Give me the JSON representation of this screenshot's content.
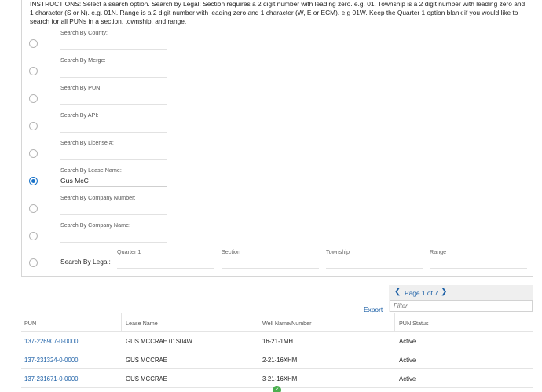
{
  "instructions": "INSTRUCTIONS: Select a search option. Search by Legal: Section requires a 2 digit number with leading zero. e.g. 01. Township is a 2 digit number with leading zero and 1 character (S or N). e.g. 01N. Range is a 2 digit number with leading zero and 1 character (W, E or ECM). e.g 01W. Keep the Quarter 1 option blank if you would like to search for all PUNs in a section, township, and range.",
  "search_options": [
    {
      "label": "Search By County:",
      "value": "",
      "selected": false
    },
    {
      "label": "Search By Merge:",
      "value": "",
      "selected": false
    },
    {
      "label": "Search By PUN:",
      "value": "",
      "selected": false
    },
    {
      "label": "Search By API:",
      "value": "",
      "selected": false
    },
    {
      "label": "Search By License #:",
      "value": "",
      "selected": false
    },
    {
      "label": "Search By Lease Name:",
      "value": "Gus McC",
      "selected": true
    },
    {
      "label": "Search By Company Number:",
      "value": "",
      "selected": false
    },
    {
      "label": "Search By Company Name:",
      "value": "",
      "selected": false
    }
  ],
  "legal": {
    "label": "Search By Legal:",
    "quarter1": "Quarter 1",
    "section": "Section",
    "township": "Township",
    "range": "Range"
  },
  "pager": {
    "text": "Page 1 of 7",
    "filter_placeholder": "Filter"
  },
  "export_label": "Export",
  "table": {
    "columns": [
      "PUN",
      "Lease Name",
      "Well Name/Number",
      "PUN Status"
    ],
    "rows": [
      [
        "137-226907-0-0000",
        "GUS MCCRAE 01S04W",
        "16-21-1MH",
        "Active"
      ],
      [
        "137-231324-0-0000",
        "GUS MCCRAE",
        "2-21-16XHM",
        "Active"
      ],
      [
        "137-231671-0-0000",
        "GUS MCCRAE",
        "3-21-16XHM",
        "Active"
      ]
    ]
  },
  "colors": {
    "accent": "#1a73c9",
    "link": "#1b5fa6",
    "pager_bg": "#efefef"
  }
}
